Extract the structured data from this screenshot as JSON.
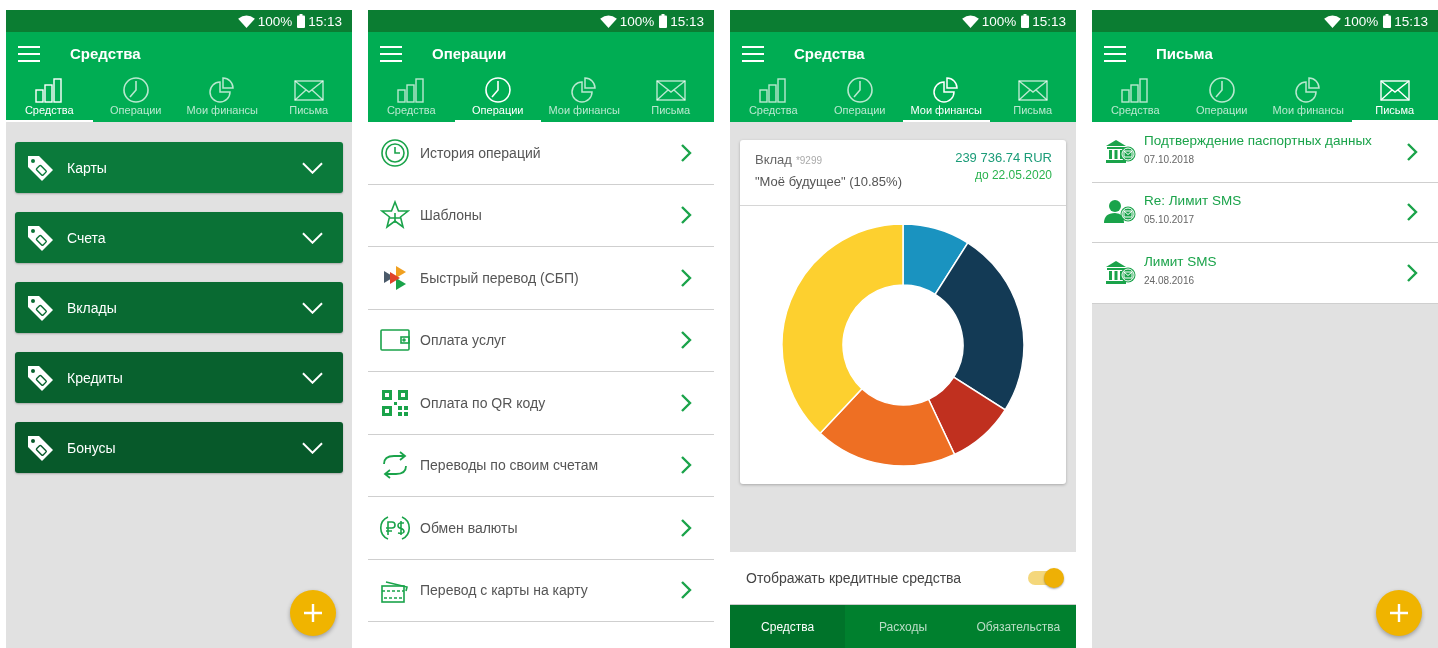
{
  "screens": [
    {
      "kind": "accounts",
      "status": {
        "battery": "100%",
        "time": "15:13"
      },
      "title": "Средства",
      "tabs": [
        {
          "label": "Средства",
          "selected": true
        },
        {
          "label": "Операции",
          "selected": false
        },
        {
          "label": "Мои финансы",
          "selected": false
        },
        {
          "label": "Письма",
          "selected": false
        }
      ],
      "sections": [
        {
          "label": "Карты",
          "expanded": false
        },
        {
          "label": "Счета",
          "expanded": false
        },
        {
          "label": "Вклады",
          "expanded": false
        },
        {
          "label": "Кредиты",
          "expanded": false
        },
        {
          "label": "Бонусы",
          "expanded": false
        }
      ],
      "fab": true
    },
    {
      "kind": "operations",
      "status": {
        "battery": "100%",
        "time": "15:13"
      },
      "title": "Операции",
      "tabs": [
        {
          "label": "Средства",
          "selected": false
        },
        {
          "label": "Операции",
          "selected": true
        },
        {
          "label": "Мои финансы",
          "selected": false
        },
        {
          "label": "Письма",
          "selected": false
        }
      ],
      "items": [
        {
          "label": "История операций"
        },
        {
          "label": "Шаблоны"
        },
        {
          "label": "Быстрый перевод (СБП)"
        },
        {
          "label": "Оплата услуг"
        },
        {
          "label": "Оплата по QR коду"
        },
        {
          "label": "Переводы по своим счетам"
        },
        {
          "label": "Обмен валюты"
        },
        {
          "label": "Перевод с карты на карту"
        }
      ],
      "fab": false
    },
    {
      "kind": "finances",
      "status": {
        "battery": "100%",
        "time": "15:13"
      },
      "title": "Средства",
      "tabs": [
        {
          "label": "Средства",
          "selected": false
        },
        {
          "label": "Операции",
          "selected": false
        },
        {
          "label": "Мои финансы",
          "selected": true
        },
        {
          "label": "Письма",
          "selected": false
        }
      ],
      "deposit": {
        "type": "Вклад",
        "number": "*9299",
        "name": "\"Моё будущее\" (10.85%)",
        "amount": "239 736.74 RUR",
        "until": "до 22.05.2020"
      },
      "toggle": {
        "label": "Отображать кредитные средства",
        "on": true
      },
      "bottom_tabs": [
        {
          "label": "Средства",
          "selected": true
        },
        {
          "label": "Расходы",
          "selected": false
        },
        {
          "label": "Обязательства",
          "selected": false
        }
      ],
      "fab": false
    },
    {
      "kind": "letters",
      "status": {
        "battery": "100%",
        "time": "15:13"
      },
      "title": "Письма",
      "tabs": [
        {
          "label": "Средства",
          "selected": false
        },
        {
          "label": "Операции",
          "selected": false
        },
        {
          "label": "Мои финансы",
          "selected": false
        },
        {
          "label": "Письма",
          "selected": true
        }
      ],
      "letters": [
        {
          "kind": "bank",
          "subject": "Подтверждение паспортных данных",
          "date": "07.10.2018"
        },
        {
          "kind": "person",
          "subject": "Re: Лимит SMS",
          "date": "05.10.2017"
        },
        {
          "kind": "bank",
          "subject": "Лимит SMS",
          "date": "24.08.2016"
        }
      ],
      "fab": true
    }
  ]
}
